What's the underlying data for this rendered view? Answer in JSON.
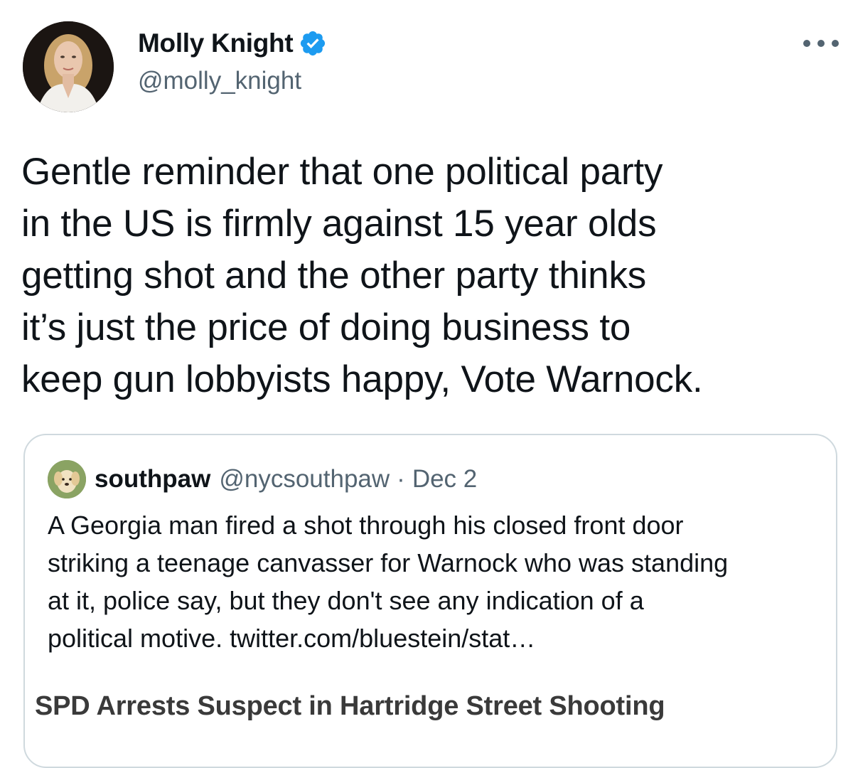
{
  "author": {
    "name": "Molly Knight",
    "handle": "@molly_knight",
    "verified": true,
    "verified_color": "#1d9bf0"
  },
  "more_icon": "more-horizontal-icon",
  "tweet": {
    "text": "Gentle reminder that one political party\nin the US is firmly against 15 year olds\ngetting shot and the other party thinks\nit’s just the price of doing business to\nkeep gun lobbyists happy, Vote Warnock."
  },
  "quoted_tweet": {
    "name": "southpaw",
    "handle": "@nycsouthpaw",
    "separator": "·",
    "date": "Dec 2",
    "text": "A Georgia man fired a shot through his closed front door\nstriking a teenage canvasser for Warnock who was standing\nat it, police say, but they don't see any indication of a\npolitical motive.  ",
    "link": "twitter.com/bluestein/stat…",
    "article_title": "SPD Arrests Suspect in Hartridge Street Shooting"
  },
  "colors": {
    "text_primary": "#0f1419",
    "text_secondary": "#536471",
    "border": "#cfd9de"
  }
}
